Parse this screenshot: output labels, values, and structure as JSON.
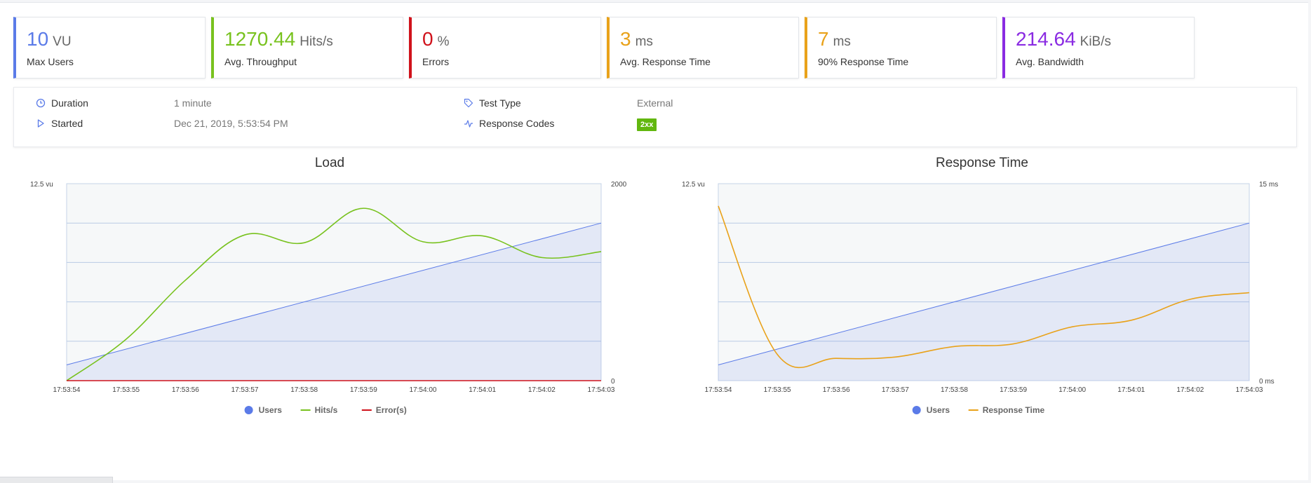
{
  "cards": [
    {
      "value": "10",
      "unit": "VU",
      "label": "Max Users",
      "color": "#5b7be8",
      "value_color": "#5b7be8"
    },
    {
      "value": "1270.44",
      "unit": "Hits/s",
      "label": "Avg. Throughput",
      "color": "#78c21e",
      "value_color": "#78c21e"
    },
    {
      "value": "0",
      "unit": "%",
      "label": "Errors",
      "color": "#d0121b",
      "value_color": "#d0121b"
    },
    {
      "value": "3",
      "unit": "ms",
      "label": "Avg. Response Time",
      "color": "#e9a21a",
      "value_color": "#e9a21a"
    },
    {
      "value": "7",
      "unit": "ms",
      "label": "90% Response Time",
      "color": "#e9a21a",
      "value_color": "#e9a21a"
    },
    {
      "value": "214.64",
      "unit": "KiB/s",
      "label": "Avg. Bandwidth",
      "color": "#8a2be2",
      "value_color": "#8a2be2"
    }
  ],
  "info": {
    "duration_label": "Duration",
    "duration_value": "1 minute",
    "started_label": "Started",
    "started_value": "Dec 21, 2019, 5:53:54 PM",
    "test_type_label": "Test Type",
    "test_type_value": "External",
    "response_codes_label": "Response Codes",
    "response_code_badge": "2xx"
  },
  "chart_data": [
    {
      "type": "line",
      "title": "Load",
      "x": [
        "17:53:54",
        "17:53:55",
        "17:53:56",
        "17:53:57",
        "17:53:58",
        "17:53:59",
        "17:54:00",
        "17:54:01",
        "17:54:02",
        "17:54:03"
      ],
      "ylabel_left_max": "12.5 vu",
      "ylabel_right_max": "2000",
      "ylabel_right_min": "0",
      "ylim_left": [
        0,
        12.5
      ],
      "ylim_right": [
        0,
        2000
      ],
      "grid": true,
      "legend_position": "bottom",
      "series": [
        {
          "name": "Users",
          "axis": "left",
          "color": "#5b7be8",
          "area": true,
          "values": [
            1,
            2,
            3,
            4,
            5,
            6,
            7,
            8,
            9,
            10
          ]
        },
        {
          "name": "Hits/s",
          "axis": "right",
          "color": "#78c21e",
          "values": [
            0,
            420,
            1020,
            1480,
            1400,
            1750,
            1410,
            1470,
            1250,
            1310
          ]
        },
        {
          "name": "Error(s)",
          "axis": "right",
          "color": "#d0121b",
          "values": [
            0,
            0,
            0,
            0,
            0,
            0,
            0,
            0,
            0,
            0
          ]
        }
      ]
    },
    {
      "type": "line",
      "title": "Response Time",
      "x": [
        "17:53:54",
        "17:53:55",
        "17:53:56",
        "17:53:57",
        "17:53:58",
        "17:53:59",
        "17:54:00",
        "17:54:01",
        "17:54:02",
        "17:54:03"
      ],
      "ylabel_left_max": "12.5 vu",
      "ylabel_right_max": "15 ms",
      "ylabel_right_min": "0 ms",
      "ylim_left": [
        0,
        12.5
      ],
      "ylim_right": [
        0,
        15
      ],
      "grid": true,
      "legend_position": "bottom",
      "series": [
        {
          "name": "Users",
          "axis": "left",
          "color": "#5b7be8",
          "area": true,
          "values": [
            1,
            2,
            3,
            4,
            5,
            6,
            7,
            8,
            9,
            10
          ]
        },
        {
          "name": "Response Time",
          "axis": "right",
          "color": "#e9a21a",
          "values": [
            13.3,
            2.0,
            1.7,
            1.8,
            2.6,
            2.8,
            4.1,
            4.6,
            6.2,
            6.7
          ]
        }
      ]
    }
  ]
}
